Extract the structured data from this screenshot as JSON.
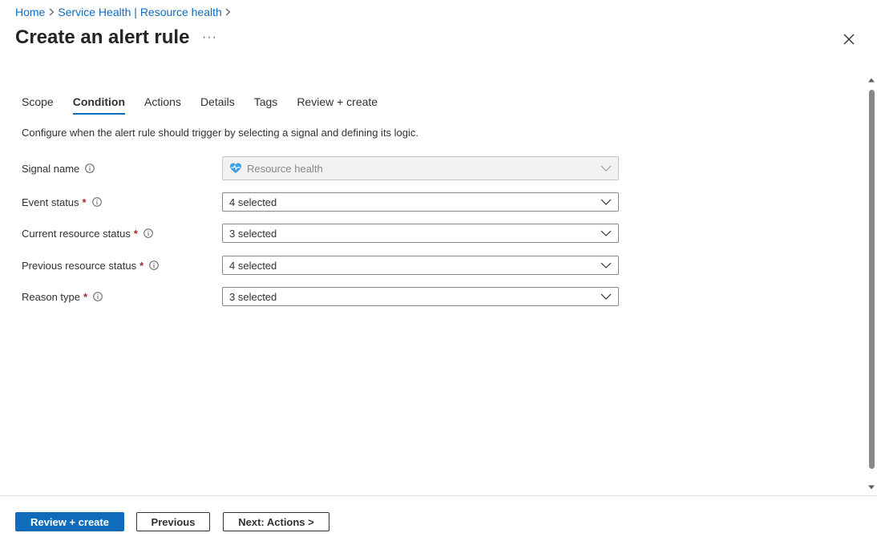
{
  "breadcrumb": [
    {
      "label": "Home"
    },
    {
      "label": "Service Health | Resource health"
    }
  ],
  "page": {
    "title": "Create an alert rule",
    "more_label": "···"
  },
  "tabs": [
    {
      "label": "Scope",
      "active": false
    },
    {
      "label": "Condition",
      "active": true
    },
    {
      "label": "Actions",
      "active": false
    },
    {
      "label": "Details",
      "active": false
    },
    {
      "label": "Tags",
      "active": false
    },
    {
      "label": "Review + create",
      "active": false
    }
  ],
  "description": "Configure when the alert rule should trigger by selecting a signal and defining its logic.",
  "form": {
    "signal": {
      "label": "Signal name",
      "value": "Resource health"
    },
    "event_status": {
      "label": "Event status",
      "value": "4 selected"
    },
    "current_status": {
      "label": "Current resource status",
      "value": "3 selected"
    },
    "previous_status": {
      "label": "Previous resource status",
      "value": "4 selected"
    },
    "reason_type": {
      "label": "Reason type",
      "value": "3 selected"
    },
    "required_marker": "*"
  },
  "footer": {
    "review_label": "Review + create",
    "previous_label": "Previous",
    "next_label": "Next: Actions >"
  },
  "colors": {
    "accent": "#0f6cbd",
    "required": "#a4262c"
  },
  "icons": {
    "close": "close-icon",
    "info": "info-icon",
    "chevron": "chevron-down-icon",
    "signal": "resource-health-icon"
  }
}
